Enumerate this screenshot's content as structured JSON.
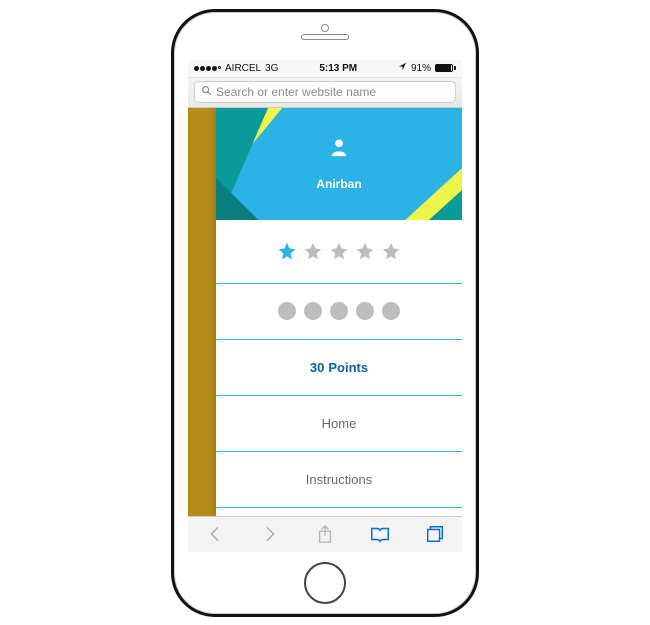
{
  "status_bar": {
    "carrier": "AIRCEL",
    "network": "3G",
    "time": "5:13 PM",
    "battery_pct": "91%"
  },
  "urlbar": {
    "placeholder": "Search or enter website name"
  },
  "profile": {
    "username": "Anirban",
    "points_value": "30",
    "points_label": "Points"
  },
  "menu": {
    "home": "Home",
    "instructions": "Instructions"
  },
  "rating": {
    "filled": 1,
    "total": 5
  },
  "dots": {
    "count": 5
  }
}
